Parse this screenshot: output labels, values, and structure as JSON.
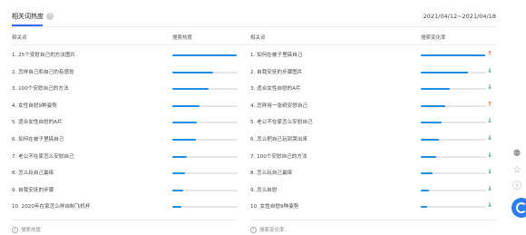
{
  "header": {
    "title": "相关词热度",
    "help_icon": "question-icon",
    "date_range": "2021/04/12~2021/04/18"
  },
  "left_panel": {
    "col_keyword": "相关词",
    "col_metric": "搜索热度",
    "items": [
      {
        "label": "1.  25个安慰自己的方法图片",
        "level": 0.98
      },
      {
        "label": "2.  怎样自己和自己的有感觉",
        "level": 0.62
      },
      {
        "label": "3.  100个安慰自己的方法",
        "level": 0.55
      },
      {
        "label": "4.  女性自慰9种姿势",
        "level": 0.42
      },
      {
        "label": "5.  适合女性自慰的A片",
        "level": 0.38
      },
      {
        "label": "6.  如何在被子里搞自己",
        "level": 0.36
      },
      {
        "label": "7.  老公不在家怎么安慰自己",
        "level": 0.22
      },
      {
        "label": "8.  怎么玩自己最痒",
        "level": 0.2
      },
      {
        "label": "9.  自我安抚的步骤",
        "level": 0.16
      },
      {
        "label": "10. 2020年在家怎么样自制飞机杯",
        "level": 0.14
      }
    ],
    "footer": "搜索热度",
    "footer_icon": "info-icon"
  },
  "right_panel": {
    "col_keyword": "相关词",
    "col_metric": "搜索变化率",
    "items": [
      {
        "label": "1.  如何在被子里搞自己",
        "level": 0.98,
        "trend": "up"
      },
      {
        "label": "2.  自我安抚的步骤图片",
        "level": 0.72,
        "trend": "down"
      },
      {
        "label": "3.  适合女性自慰的A片",
        "level": 0.45,
        "trend": "down"
      },
      {
        "label": "4.  怎样用一张纸安慰自己",
        "level": 0.38,
        "trend": "up"
      },
      {
        "label": "5.  老公不在家怎么安慰自己",
        "level": 0.32,
        "trend": "down"
      },
      {
        "label": "6.  怎么把自己玩到哭出来",
        "level": 0.28,
        "trend": "down"
      },
      {
        "label": "7.  100个安慰自己的方法",
        "level": 0.24,
        "trend": "down"
      },
      {
        "label": "8.  怎么玩自己最痒",
        "level": 0.18,
        "trend": "down"
      },
      {
        "label": "9.  怎么自慰",
        "level": 0.12,
        "trend": "down"
      },
      {
        "label": "10. 女性自慰9种姿势",
        "level": 0.1,
        "trend": "down"
      }
    ],
    "footer": "搜索变化率",
    "footer_icon": "info-icon"
  },
  "colors": {
    "accent": "#2d66f0",
    "bar": "#1e8fe0",
    "trend_up": "#e8622a",
    "trend_down": "#2aa06b"
  },
  "side_tools": [
    "share-icon",
    "star-icon",
    "help-icon"
  ]
}
